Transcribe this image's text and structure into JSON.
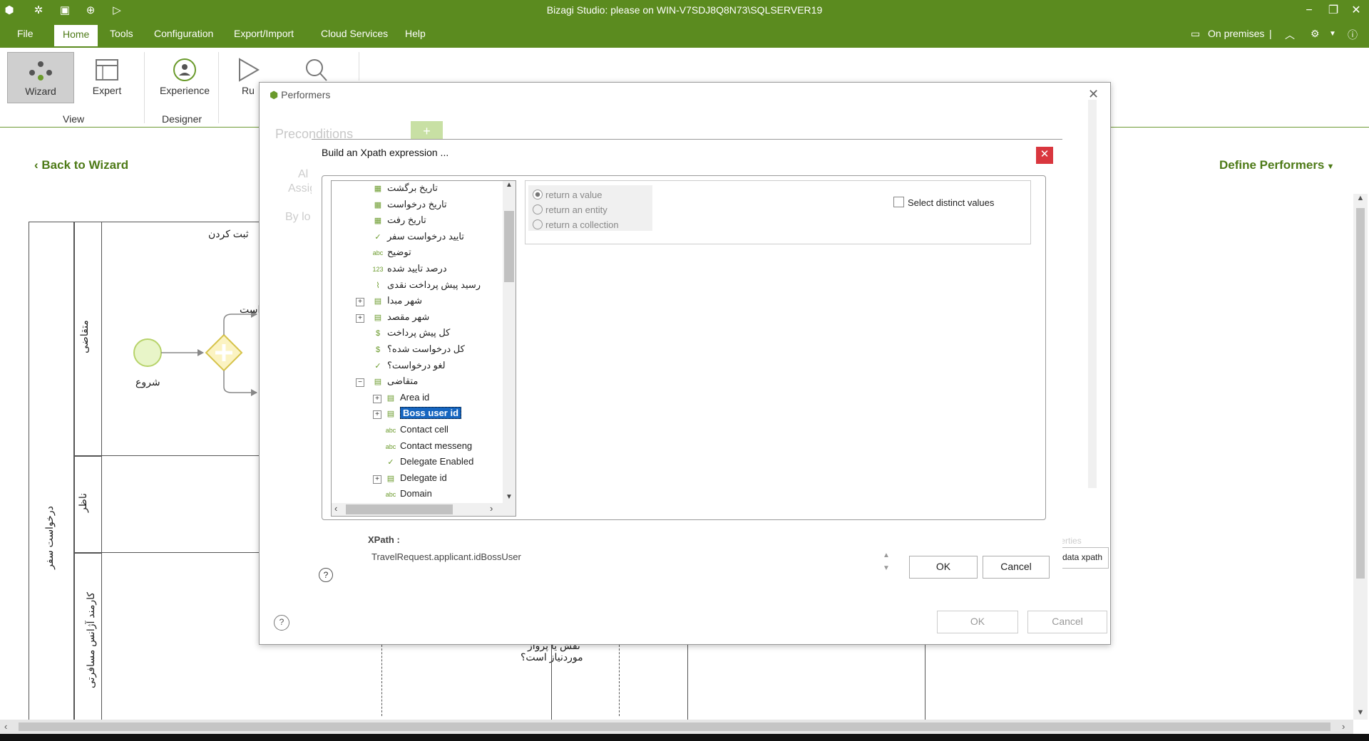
{
  "window": {
    "title": "Bizagi Studio: please  on WIN-V7SDJ8Q8N73\\SQLSERVER19",
    "minimize": "−",
    "restore": "❐",
    "close": "✕"
  },
  "menu": {
    "items": [
      "File",
      "Home",
      "Tools",
      "Configuration",
      "Export/Import",
      "Cloud Services",
      "Help"
    ],
    "active": "Home",
    "right_label": "On premises"
  },
  "ribbon": {
    "wizard": "Wizard",
    "expert": "Expert",
    "experience": "Experience",
    "run": "Ru",
    "group_view": "View",
    "group_designer": "Designer"
  },
  "canvas": {
    "back_link": "Back to Wizard",
    "define_performers": "Define Performers",
    "pool_name": "درخواست سفر",
    "lane1": "متقاضی",
    "lane2": "ناظر",
    "lane3": "کارمند آژانس مسافرتی",
    "task_register": "ثبت کردن",
    "start_label": "شروع",
    "partial_label": "است",
    "bottom_text1": "نقش یا پرواز",
    "bottom_text2": "موردنیاز است؟"
  },
  "performers_dialog": {
    "title": "Performers",
    "preconditions": "Preconditions",
    "assign_partial": "Assig",
    "by_partial": "By lo",
    "all_partial": "Al",
    "properties_partial": "operties",
    "tooltip": "data xpath",
    "ok": "OK",
    "cancel": "Cancel"
  },
  "xpath_dialog": {
    "title": "Build an Xpath expression ...",
    "tree_items": [
      {
        "label": "تاریخ برگشت",
        "icon": "calendar-icon",
        "rtl": true
      },
      {
        "label": "تاریخ درخواست",
        "icon": "calendar-icon",
        "rtl": true
      },
      {
        "label": "تاریخ رفت",
        "icon": "calendar-icon",
        "rtl": true
      },
      {
        "label": "تایید درخواست سفر",
        "icon": "check-icon",
        "rtl": true
      },
      {
        "label": "توضیح",
        "icon": "text-icon",
        "rtl": true
      },
      {
        "label": "درصد تایید شده",
        "icon": "number-icon",
        "rtl": true
      },
      {
        "label": "رسید پیش پرداخت نقدی",
        "icon": "attachment-icon",
        "rtl": true
      },
      {
        "label": "شهر مبدا",
        "icon": "entity-icon",
        "rtl": true,
        "expand": "+"
      },
      {
        "label": "شهر مقصد",
        "icon": "entity-icon",
        "rtl": true,
        "expand": "+"
      },
      {
        "label": "کل پیش پرداخت",
        "icon": "money-icon",
        "rtl": true
      },
      {
        "label": "کل درخواست شده؟",
        "icon": "money-icon",
        "rtl": true
      },
      {
        "label": "لغو درخواست؟",
        "icon": "check-icon",
        "rtl": true
      },
      {
        "label": "متقاضی",
        "icon": "entity-icon",
        "rtl": true,
        "expand": "−"
      },
      {
        "label": "Area id",
        "icon": "entity-icon",
        "expand": "+"
      },
      {
        "label": "Boss user id",
        "icon": "entity-icon",
        "expand": "+",
        "selected": true
      },
      {
        "label": "Contact cell",
        "icon": "text-icon"
      },
      {
        "label": "Contact messeng",
        "icon": "text-icon"
      },
      {
        "label": "Delegate Enabled",
        "icon": "check-icon"
      },
      {
        "label": "Delegate id",
        "icon": "entity-icon",
        "expand": "+"
      },
      {
        "label": "Domain",
        "icon": "text-icon"
      }
    ],
    "options": {
      "return_value": "return a value",
      "return_entity": "return an entity",
      "return_collection": "return a collection",
      "select_distinct": "Select distinct values"
    },
    "xpath_label": "XPath :",
    "xpath_value": "TravelRequest.applicant.idBossUser",
    "ok": "OK",
    "cancel": "Cancel",
    "help": "?"
  },
  "colors": {
    "brand_green": "#5b8b1f",
    "accent_text": "#4d7a17",
    "selection_blue": "#1565c0",
    "close_red": "#d9363e"
  }
}
